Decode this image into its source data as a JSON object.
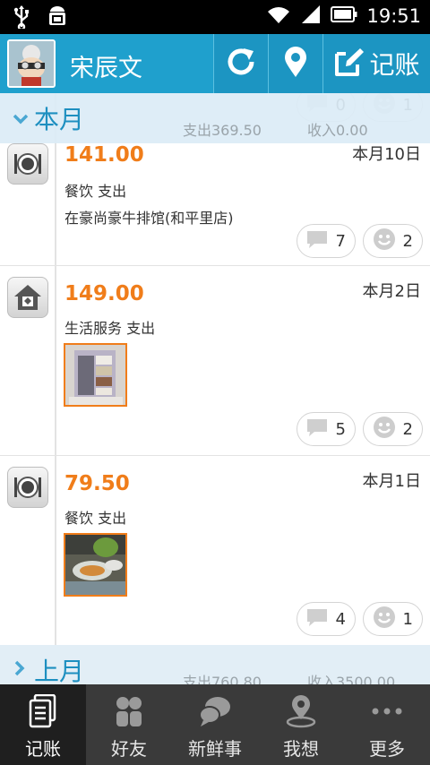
{
  "status_bar": {
    "time": "19:51",
    "icons": [
      "usb-icon",
      "android-debug-icon",
      "wifi-icon",
      "signal-icon",
      "battery-icon"
    ]
  },
  "header": {
    "user_name": "宋辰文",
    "record_label": "记账",
    "icons": [
      "refresh-icon",
      "location-pin-icon",
      "edit-icon"
    ],
    "accent_color": "#1fa0cd"
  },
  "this_month": {
    "title": "本月",
    "expense_label": "支出369.50",
    "income_label": "收入0.00",
    "partial_comment_count": "0",
    "partial_like_count": "1"
  },
  "entries": [
    {
      "icon": "dining-plate-icon",
      "amount": "141.00",
      "date": "本月10日",
      "category": "餐饮 支出",
      "place": "在豪尚豪牛排馆(和平里店)",
      "comments": "7",
      "likes": "2",
      "photo": null
    },
    {
      "icon": "house-service-icon",
      "amount": "149.00",
      "date": "本月2日",
      "category": "生活服务 支出",
      "place": "",
      "comments": "5",
      "likes": "2",
      "photo": "wardrobe-photo"
    },
    {
      "icon": "dining-plate-icon",
      "amount": "79.50",
      "date": "本月1日",
      "category": "餐饮 支出",
      "place": "",
      "comments": "4",
      "likes": "1",
      "photo": "food-photo"
    }
  ],
  "last_month": {
    "title": "上月",
    "expense_label": "支出760.80",
    "income_label": "收入3500.00"
  },
  "bottom_nav": {
    "items": [
      {
        "label": "记账",
        "icon": "ledger-icon",
        "active": true
      },
      {
        "label": "好友",
        "icon": "friends-icon",
        "active": false
      },
      {
        "label": "新鲜事",
        "icon": "chat-bubbles-icon",
        "active": false
      },
      {
        "label": "我想",
        "icon": "location-wish-icon",
        "active": false
      },
      {
        "label": "更多",
        "icon": "more-dots-icon",
        "active": false
      }
    ]
  },
  "colors": {
    "amount": "#f07d1a",
    "month_title": "#1d8fc0",
    "nav_bg": "#3a3a3a"
  }
}
